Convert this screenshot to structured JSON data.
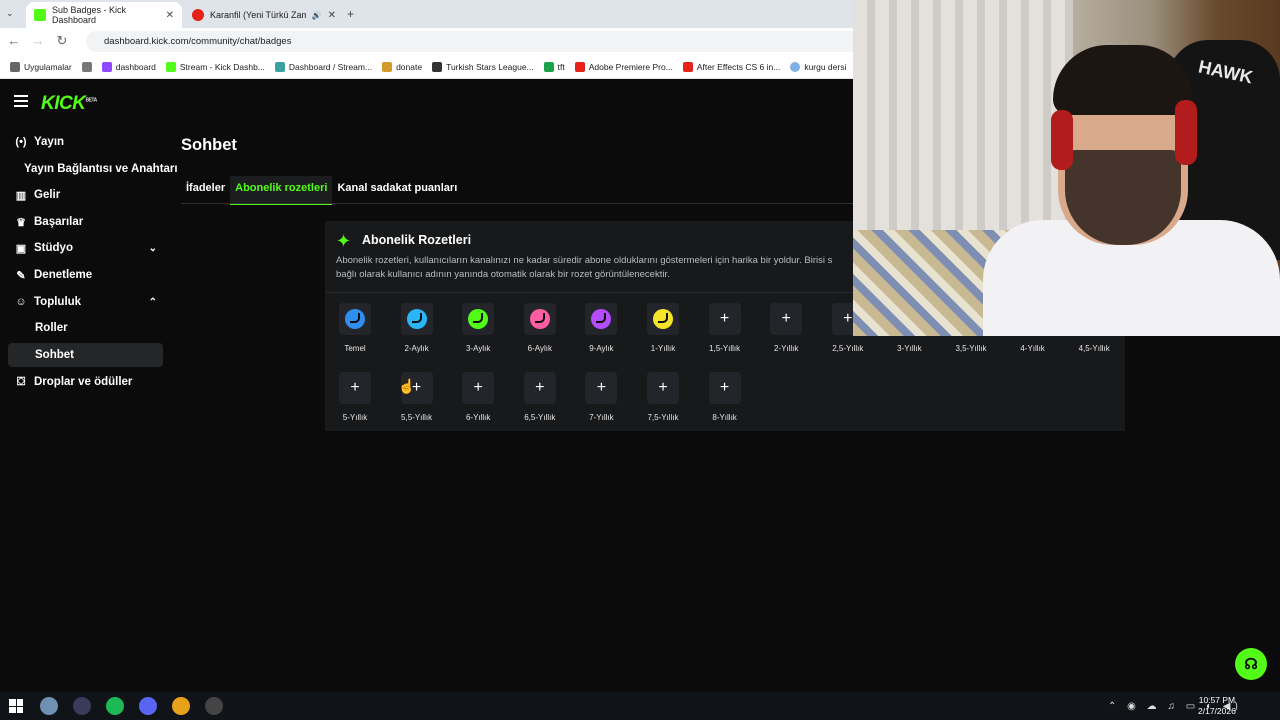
{
  "browser": {
    "tabs": [
      {
        "title": "Sub Badges - Kick Dashboard",
        "active": true,
        "color": "#53fc18"
      },
      {
        "title": "Karanfil (Yeni Türkü Zaman",
        "active": false,
        "color": "#e62117"
      }
    ],
    "url": "dashboard.kick.com/community/chat/badges",
    "bookmarks": [
      {
        "label": "Uygulamalar",
        "color": "#666666"
      },
      {
        "label": "dashboard",
        "color": "#9146ff"
      },
      {
        "label": "Stream - Kick Dashb...",
        "color": "#53fc18"
      },
      {
        "label": "Dashboard / Stream...",
        "color": "#3aa0a0"
      },
      {
        "label": "donate",
        "color": "#d49a2a"
      },
      {
        "label": "Turkish Stars League...",
        "color": "#333333"
      },
      {
        "label": "tft",
        "color": "#1aa34a"
      },
      {
        "label": "Adobe Premiere Pro...",
        "color": "#e62117"
      },
      {
        "label": "After Effects CS 6 in...",
        "color": "#e62117"
      },
      {
        "label": "kurgu dersi",
        "color": "#7fb0e8"
      }
    ]
  },
  "app": {
    "logo": "KICK",
    "logo_tag": "BETA",
    "nav": [
      {
        "label": "Yayın",
        "icon": "broadcast-icon",
        "glyph": "(•)"
      },
      {
        "label": "Yayın Bağlantısı ve Anahtarı",
        "sub": true
      },
      {
        "label": "Gelir",
        "icon": "chart-icon",
        "glyph": "▥"
      },
      {
        "label": "Başarılar",
        "icon": "trophy-icon",
        "glyph": "♛"
      },
      {
        "label": "Stüdyo",
        "icon": "studio-icon",
        "glyph": "▣",
        "chevron": "⌄"
      },
      {
        "label": "Denetleme",
        "icon": "wrench-icon",
        "glyph": "✎"
      },
      {
        "label": "Topluluk",
        "icon": "community-icon",
        "glyph": "☺",
        "chevron": "⌃"
      },
      {
        "label": "Roller",
        "sub": true
      },
      {
        "label": "Sohbet",
        "sub": true,
        "active": true
      },
      {
        "label": "Droplar ve ödüller",
        "icon": "gift-icon",
        "glyph": "⛋"
      }
    ],
    "page_title": "Sohbet",
    "tabs": [
      {
        "label": "İfadeler",
        "active": false
      },
      {
        "label": "Abonelik rozetleri",
        "active": true
      },
      {
        "label": "Kanal sadakat puanları",
        "active": false
      }
    ],
    "card": {
      "title": "Abonelik Rozetleri",
      "desc_line1": "Abonelik rozetleri, kullanıcıların kanalınızı ne kadar süredir abone olduklarını göstermeleri için harika bir yoldur. Birisi s",
      "desc_line2": "bağlı olarak kullanıcı adının yanında otomatik olarak bir rozet görüntülenecektir."
    },
    "badges_row1": [
      {
        "label": "Temel",
        "color": "#2f8ff0"
      },
      {
        "label": "2-Aylık",
        "color": "#29b6f6"
      },
      {
        "label": "3-Aylık",
        "color": "#53fc18"
      },
      {
        "label": "6-Aylık",
        "color": "#ff5fa2"
      },
      {
        "label": "9-Aylık",
        "color": "#b44cff"
      },
      {
        "label": "1-Yıllık",
        "color": "#f5e52a"
      },
      {
        "label": "1,5-Yıllık",
        "add": "+"
      },
      {
        "label": "2-Yıllık",
        "add": "+"
      },
      {
        "label": "2,5-Yıllık",
        "add": "+"
      },
      {
        "label": "3-Yıllık",
        "add": "+"
      },
      {
        "label": "3,5-Yıllık",
        "add": "+"
      },
      {
        "label": "4-Yıllık",
        "add": "+"
      },
      {
        "label": "4,5-Yıllık",
        "add": "+"
      }
    ],
    "badges_row2": [
      {
        "label": "5-Yıllık",
        "add": "+"
      },
      {
        "label": "5,5-Yıllık",
        "add": "+"
      },
      {
        "label": "6-Yıllık",
        "add": "+"
      },
      {
        "label": "6,5-Yıllık",
        "add": "+"
      },
      {
        "label": "7-Yıllık",
        "add": "+"
      },
      {
        "label": "7,5-Yıllık",
        "add": "+"
      },
      {
        "label": "8-Yıllık",
        "add": "+"
      }
    ],
    "camera_overlay_text": "HAWK"
  },
  "taskbar": {
    "time": "10:57 PM",
    "date": "2/17/2026",
    "apps": [
      {
        "name": "start-icon",
        "color": "#3aa0ff"
      },
      {
        "name": "app-icon",
        "color": "#6f8fb3"
      },
      {
        "name": "controller-icon",
        "color": "#3a3a5a"
      },
      {
        "name": "spotify-icon",
        "color": "#1db954"
      },
      {
        "name": "discord-icon",
        "color": "#5865f2"
      },
      {
        "name": "chrome-icon",
        "color": "#e8a21a"
      },
      {
        "name": "obs-icon",
        "color": "#444444"
      }
    ]
  }
}
